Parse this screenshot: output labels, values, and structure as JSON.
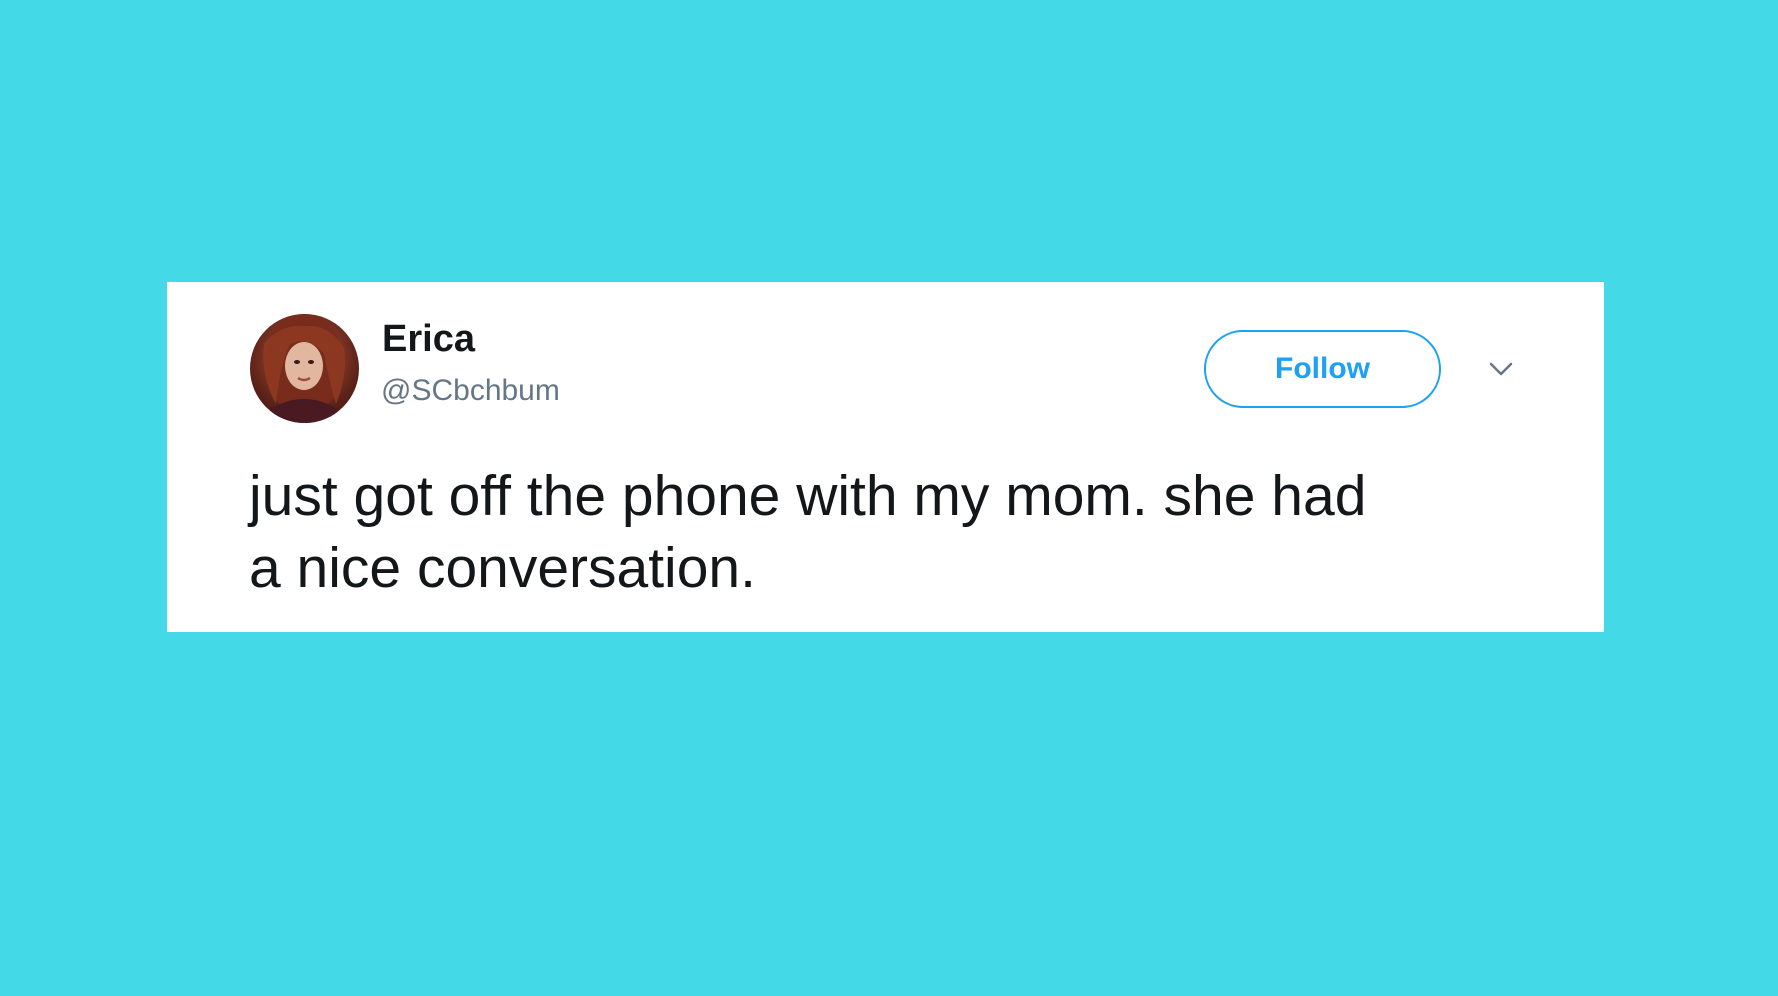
{
  "colors": {
    "background": "#44d9e6",
    "card": "#ffffff",
    "accent": "#1da1f2",
    "text_primary": "#14171a",
    "text_secondary": "#657786"
  },
  "tweet": {
    "author": {
      "name": "Erica",
      "handle": "@SCbchbum",
      "avatar_icon": "profile-photo"
    },
    "follow_label": "Follow",
    "menu_icon": "chevron-down-icon",
    "text_line1": "just got off the phone with my mom. she had",
    "text_line2": "a nice conversation."
  }
}
